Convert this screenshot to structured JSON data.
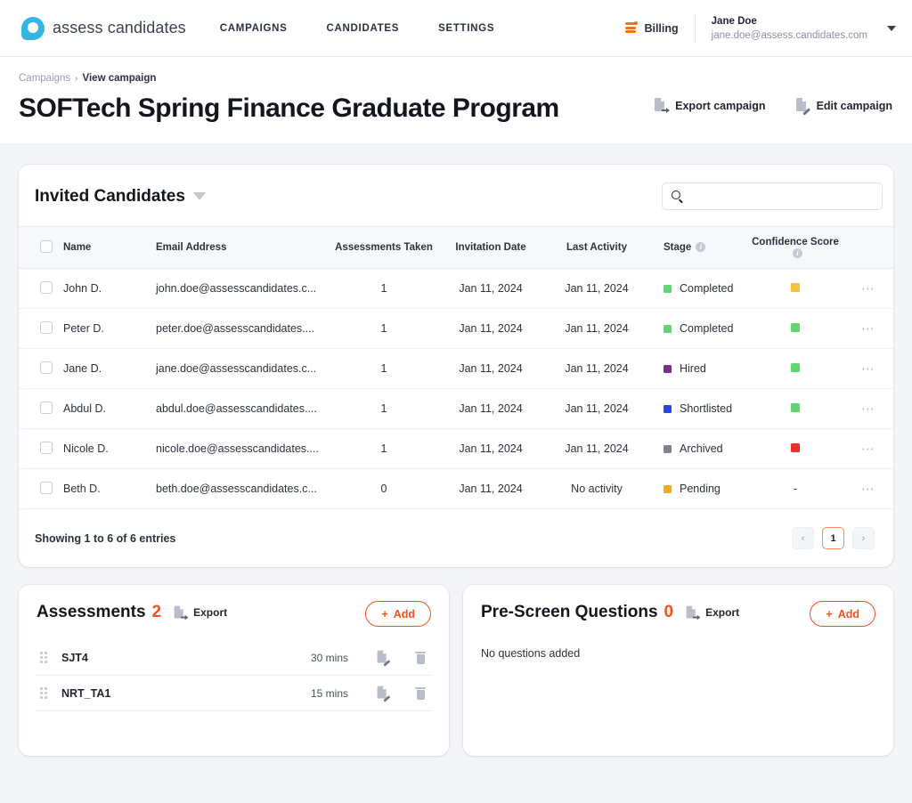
{
  "nav": {
    "brand": "assess candidates",
    "brand_icon": "speech-bubble-logo",
    "links": [
      {
        "label": "CAMPAIGNS"
      },
      {
        "label": "CANDIDATES"
      },
      {
        "label": "SETTINGS"
      }
    ],
    "billing": {
      "label": "Billing",
      "icon": "coins-icon",
      "color": "#f36f21"
    },
    "user": {
      "name": "Jane Doe",
      "email": "jane.doe@assess.candidates.com"
    }
  },
  "breadcrumb": {
    "parent": "Campaigns",
    "separator": "›",
    "current": "View campaign"
  },
  "page": {
    "title": "SOFTech Spring Finance Graduate Program",
    "actions": [
      {
        "label": "Export campaign",
        "icon": "document-export-icon"
      },
      {
        "label": "Edit campaign",
        "icon": "document-edit-icon"
      }
    ]
  },
  "table": {
    "title": "Invited Candidates",
    "filter_icon": "funnel-icon",
    "search": {
      "placeholder": "",
      "value": "",
      "icon": "search-icon"
    },
    "columns": [
      {
        "key": "select",
        "label": ""
      },
      {
        "key": "name",
        "label": "Name"
      },
      {
        "key": "email",
        "label": "Email Address"
      },
      {
        "key": "taken",
        "label": "Assessments Taken"
      },
      {
        "key": "invited",
        "label": "Invitation Date"
      },
      {
        "key": "activity",
        "label": "Last Activity"
      },
      {
        "key": "stage",
        "label": "Stage",
        "info": true
      },
      {
        "key": "confidence",
        "label": "Confidence Score",
        "info": true
      },
      {
        "key": "more",
        "label": ""
      }
    ],
    "rows": [
      {
        "name": "John D.",
        "email": "john.doe@assesscandidates.c...",
        "taken": "1",
        "invited": "Jan 11, 2024",
        "activity": "Jan 11, 2024",
        "stage": "Completed",
        "stage_color": "#5fd66f",
        "confidence_color": "#f5c23d",
        "confidence_text": ""
      },
      {
        "name": "Peter D.",
        "email": "peter.doe@assesscandidates....",
        "taken": "1",
        "invited": "Jan 11, 2024",
        "activity": "Jan 11, 2024",
        "stage": "Completed",
        "stage_color": "#5fd66f",
        "confidence_color": "#5fd66f",
        "confidence_text": ""
      },
      {
        "name": "Jane D.",
        "email": "jane.doe@assesscandidates.c...",
        "taken": "1",
        "invited": "Jan 11, 2024",
        "activity": "Jan 11, 2024",
        "stage": "Hired",
        "stage_color": "#7b2d8b",
        "confidence_color": "#5fd66f",
        "confidence_text": ""
      },
      {
        "name": "Abdul D.",
        "email": "abdul.doe@assesscandidates....",
        "taken": "1",
        "invited": "Jan 11, 2024",
        "activity": "Jan 11, 2024",
        "stage": "Shortlisted",
        "stage_color": "#2b43e8",
        "confidence_color": "#5fd66f",
        "confidence_text": ""
      },
      {
        "name": "Nicole D.",
        "email": "nicole.doe@assesscandidates....",
        "taken": "1",
        "invited": "Jan 11, 2024",
        "activity": "Jan 11, 2024",
        "stage": "Archived",
        "stage_color": "#80848f",
        "confidence_color": "#ec2f26",
        "confidence_text": ""
      },
      {
        "name": "Beth D.",
        "email": "beth.doe@assesscandidates.c...",
        "taken": "0",
        "invited": "Jan 11, 2024",
        "activity": "No activity",
        "stage": "Pending",
        "stage_color": "#f5a623",
        "confidence_color": "",
        "confidence_text": "-"
      }
    ],
    "row_menu_icon": "ellipsis-icon",
    "footer": {
      "showing": "Showing 1 to 6 of 6 entries"
    },
    "pagination": {
      "prev": "‹",
      "pages": [
        "1"
      ],
      "next": "›",
      "active": "1",
      "active_color": "#f58b57"
    }
  },
  "assessments_panel": {
    "title": "Assessments",
    "count": "2",
    "export": {
      "label": "Export",
      "icon": "document-export-icon"
    },
    "add": {
      "label": "Add",
      "icon": "plus-icon",
      "color": "#f4511e"
    },
    "items": [
      {
        "name": "SJT4",
        "duration": "30 mins",
        "drag_icon": "drag-handle-icon",
        "edit_icon": "document-edit-icon",
        "delete_icon": "trash-icon"
      },
      {
        "name": "NRT_TA1",
        "duration": "15 mins",
        "drag_icon": "drag-handle-icon",
        "edit_icon": "document-edit-icon",
        "delete_icon": "trash-icon"
      }
    ]
  },
  "prescreen_panel": {
    "title": "Pre-Screen Questions",
    "count": "0",
    "export": {
      "label": "Export",
      "icon": "document-export-icon"
    },
    "add": {
      "label": "Add",
      "icon": "plus-icon",
      "color": "#f4511e"
    },
    "empty_message": "No questions added"
  }
}
